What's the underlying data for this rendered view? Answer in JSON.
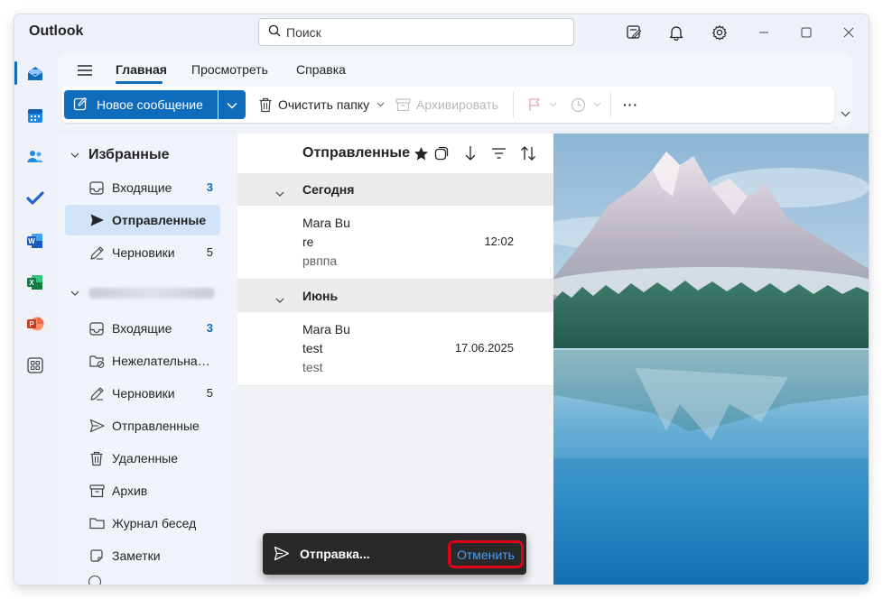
{
  "app": {
    "title": "Outlook"
  },
  "search": {
    "placeholder": "Поиск"
  },
  "ribbon": {
    "tabs": [
      {
        "label": "Главная",
        "active": true
      },
      {
        "label": "Просмотреть",
        "active": false
      },
      {
        "label": "Справка",
        "active": false
      }
    ],
    "new_message_label": "Новое сообщение",
    "empty_folder_label": "Очистить папку",
    "archive_label": "Архивировать",
    "more_label": "···"
  },
  "favorites": {
    "header": "Избранные",
    "items": [
      {
        "label": "Входящие",
        "count": "3",
        "icon": "inbox-icon"
      },
      {
        "label": "Отправленные",
        "count": "",
        "icon": "send-icon",
        "selected": true
      },
      {
        "label": "Черновики",
        "count": "5",
        "icon": "drafts-icon"
      }
    ]
  },
  "account": {
    "folders": [
      {
        "label": "Входящие",
        "count": "3",
        "icon": "inbox-icon"
      },
      {
        "label": "Нежелательная почта",
        "count": "",
        "icon": "junk-icon"
      },
      {
        "label": "Черновики",
        "count": "5",
        "icon": "drafts-icon"
      },
      {
        "label": "Отправленные",
        "count": "",
        "icon": "send-icon"
      },
      {
        "label": "Удаленные",
        "count": "",
        "icon": "trash-icon"
      },
      {
        "label": "Архив",
        "count": "",
        "icon": "archive-icon"
      },
      {
        "label": "Журнал бесед",
        "count": "",
        "icon": "folder-icon"
      },
      {
        "label": "Заметки",
        "count": "",
        "icon": "notes-icon"
      }
    ]
  },
  "maillist": {
    "title": "Отправленные",
    "groups": [
      {
        "label": "Сегодня",
        "messages": [
          {
            "from": "Mara Bu",
            "subject": "re",
            "preview": "рвппа",
            "time": "12:02"
          }
        ]
      },
      {
        "label": "Июнь",
        "messages": [
          {
            "from": "Mara Bu",
            "subject": "test",
            "preview": "test",
            "time": "17.06.2025"
          }
        ]
      }
    ]
  },
  "toast": {
    "message": "Отправка...",
    "undo_label": "Отменить"
  },
  "colors": {
    "accent": "#0f6cbd",
    "toast_bg": "#292929",
    "undo_highlight": "#e0001a",
    "link": "#479ef5"
  }
}
